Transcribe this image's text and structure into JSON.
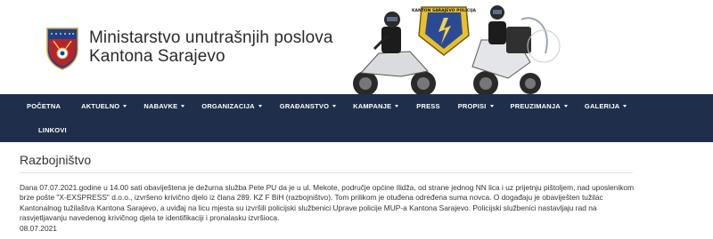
{
  "header": {
    "title_line1": "Ministarstvo unutrašnjih poslova",
    "title_line2": "Kantona Sarajevo",
    "hero_badge_text": "KANTON SARAJEVO POLICIJA"
  },
  "nav": {
    "row1": [
      {
        "label": "POČETNA",
        "dropdown": false
      },
      {
        "label": "AKTUELNO",
        "dropdown": true
      },
      {
        "label": "NABAVKE",
        "dropdown": true
      },
      {
        "label": "ORGANIZACIJA",
        "dropdown": true
      },
      {
        "label": "GRAĐANSTVO",
        "dropdown": true
      },
      {
        "label": "KAMPANJE",
        "dropdown": true
      },
      {
        "label": "PRESS",
        "dropdown": false
      },
      {
        "label": "PROPISI",
        "dropdown": true
      },
      {
        "label": "PREUZIMANJA",
        "dropdown": true
      },
      {
        "label": "GALERIJA",
        "dropdown": true
      }
    ],
    "row2": [
      {
        "label": "LINKOVI",
        "dropdown": false
      }
    ]
  },
  "article": {
    "title": "Razbojništvo",
    "body": "Dana 07.07.2021.godine u 14.00 sati obaviještena je dežurna služba Pete PU da je u ul. Mekote, područje općine Ilidža, od strane jednog NN lica i uz prijetnju pištoljem, nad uposlenikom brze pošte \"X-EXSPRESS\" d.o.o., izvršeno krivično djelo iz člana 289. KZ F BiH (razbojništvo). Tom prilikom je otuđena određena suma novca. O događaju je obaviješten tužilac Kantonalnog tužilaštva Kantona Sarajevo, a uviđaj na licu mjesta su izvršili policijski službenici Uprave policije MUP-a Kantona Sarajevo. Policijski službenici nastavljaju rad na rasvjetljavanju navedenog krivičnog djela te identifikaciji i pronalasku izvršioca.",
    "date": "08.07.2021"
  },
  "colors": {
    "navbar": "#1f2f4b",
    "nav_text": "#ffffff",
    "body_text": "#333333"
  }
}
